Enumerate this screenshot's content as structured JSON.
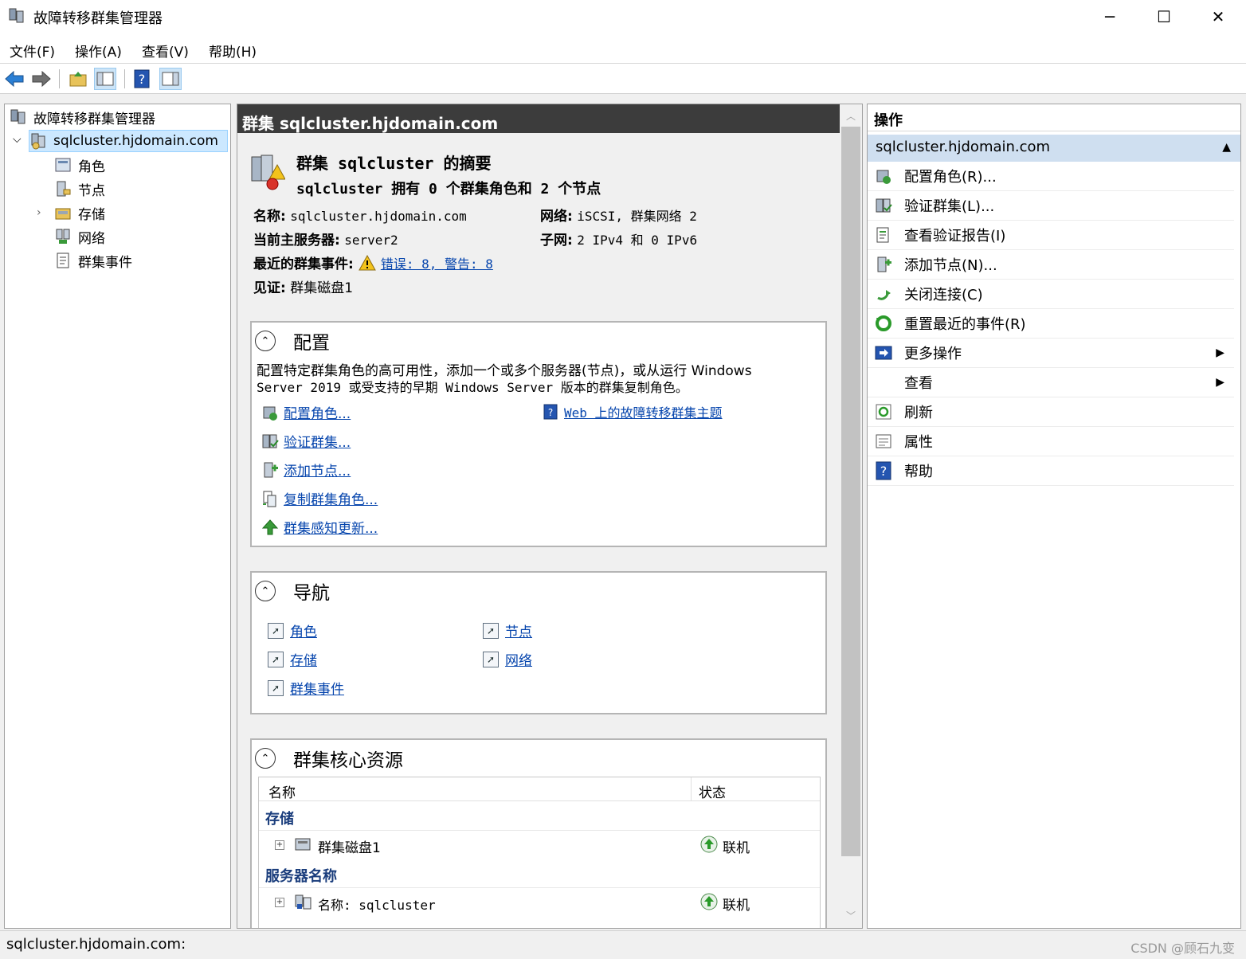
{
  "window": {
    "title": "故障转移群集管理器",
    "minimize": "─",
    "maximize": "☐",
    "close": "✕"
  },
  "menu": [
    "文件(F)",
    "操作(A)",
    "查看(V)",
    "帮助(H)"
  ],
  "tree": {
    "root": "故障转移群集管理器",
    "cluster": "sqlcluster.hjdomain.com",
    "children": [
      "角色",
      "节点",
      "存储",
      "网络",
      "群集事件"
    ]
  },
  "center": {
    "header": "群集 sqlcluster.hjdomain.com",
    "summary_title": "群集 sqlcluster 的摘要",
    "summary_sub": "sqlcluster 拥有 0 个群集角色和 2 个节点",
    "name_label": "名称:",
    "name_value": "sqlcluster.hjdomain.com",
    "network_label": "网络:",
    "network_value": "iSCSI, 群集网络 2",
    "host_label": "当前主服务器:",
    "host_value": "server2",
    "subnet_label": "子网:",
    "subnet_value": "2 IPv4 和 0 IPv6",
    "events_label": "最近的群集事件:",
    "events_value": "错误: 8, 警告: 8",
    "witness_label": "见证:",
    "witness_value": "群集磁盘1",
    "config": {
      "title": "配置",
      "desc1": "配置特定群集角色的高可用性，添加一个或多个服务器(节点)，或从运行 Windows",
      "desc2": "Server 2019 或受支持的早期 Windows Server 版本的群集复制角色。",
      "links": [
        "配置角色...",
        "验证群集...",
        "添加节点...",
        "复制群集角色...",
        "群集感知更新..."
      ],
      "web_link": "Web 上的故障转移群集主题"
    },
    "nav": {
      "title": "导航",
      "links": [
        "角色",
        "节点",
        "存储",
        "网络",
        "群集事件"
      ]
    },
    "core": {
      "title": "群集核心资源",
      "col_name": "名称",
      "col_status": "状态",
      "groups": [
        {
          "name": "存储",
          "item": "群集磁盘1",
          "status": "联机"
        },
        {
          "name": "服务器名称",
          "item": "名称: sqlcluster",
          "status": "联机"
        }
      ]
    }
  },
  "actions": {
    "title": "操作",
    "subheader": "sqlcluster.hjdomain.com",
    "items": [
      "配置角色(R)...",
      "验证群集(L)...",
      "查看验证报告(I)",
      "添加节点(N)...",
      "关闭连接(C)",
      "重置最近的事件(R)",
      "更多操作",
      "查看",
      "刷新",
      "属性",
      "帮助"
    ]
  },
  "status": {
    "text": "sqlcluster.hjdomain.com:",
    "watermark": "CSDN @顾石九变"
  },
  "colors": {
    "header_bg": "#3c3c3c",
    "action_sub_bg": "#cfdff0",
    "link": "#0645ad",
    "tree_selected": "#cce8ff"
  }
}
